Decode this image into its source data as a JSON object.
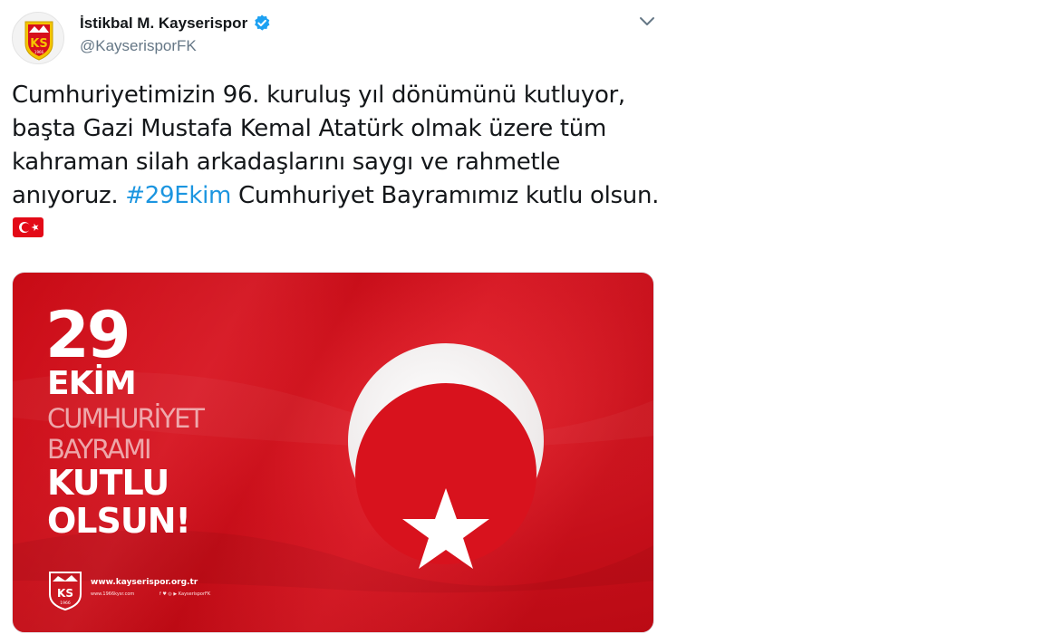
{
  "header": {
    "display_name": "İstikbal M. Kayserispor",
    "handle": "@KayserisporFK",
    "verified_icon": "verified-badge-icon",
    "menu_icon": "chevron-down-icon"
  },
  "tweet": {
    "line1": "Cumhuriyetimizin 96. kuruluş yıl dönümünü kutluyor,",
    "line2": "başta Gazi Mustafa Kemal Atatürk olmak üzere tüm",
    "line3": "kahraman silah arkadaşlarını saygı ve rahmetle",
    "line4_prefix": "anıyoruz. ",
    "hashtag": "#29Ekim",
    "line4_suffix": " Cumhuriyet Bayramımız kutlu olsun.",
    "emoji": "turkish-flag-emoji"
  },
  "media": {
    "number": "29",
    "month": "EKİM",
    "word1": "CUMHURİYET",
    "word2": "BAYRAMI",
    "word3": "KUTLU",
    "word4": "OLSUN!",
    "website": "www.kayserispor.org.tr",
    "small_left": "www.1966kysr.com",
    "small_right": "f ♥ ◎ ▶ KayserisporFK",
    "logo_text": "KS",
    "logo_year": "1966"
  },
  "colors": {
    "brand_blue": "#1b95e0",
    "flag_red": "#d6101c",
    "club_yellow": "#f5c400"
  }
}
